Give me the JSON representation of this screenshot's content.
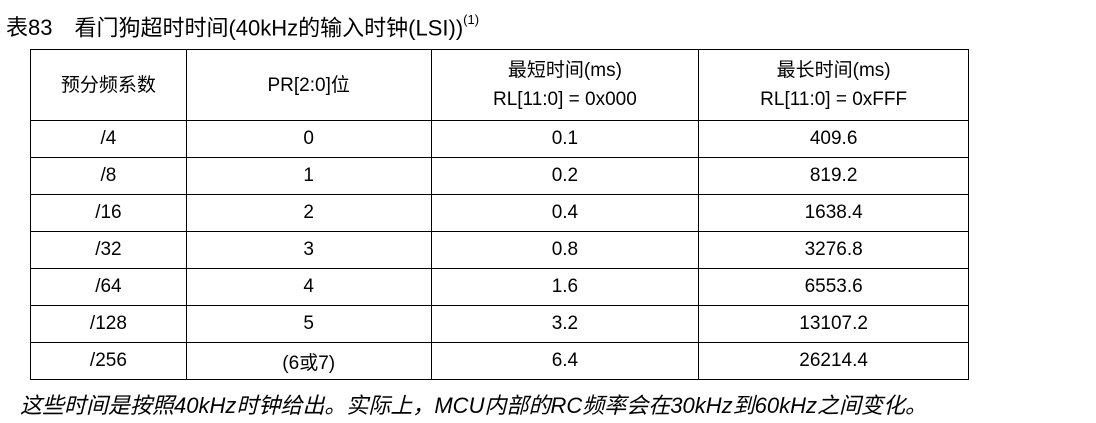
{
  "caption": {
    "number": "表83",
    "title": "看门狗超时时间(40kHz的输入时钟(LSI))",
    "footnote_ref": "(1)"
  },
  "table": {
    "headers": [
      {
        "line1": "预分频系数",
        "line2": ""
      },
      {
        "line1": "PR[2:0]位",
        "line2": ""
      },
      {
        "line1": "最短时间(ms)",
        "line2": "RL[11:0] = 0x000"
      },
      {
        "line1": "最长时间(ms)",
        "line2": "RL[11:0] = 0xFFF"
      }
    ],
    "rows": [
      [
        "/4",
        "0",
        "0.1",
        "409.6"
      ],
      [
        "/8",
        "1",
        "0.2",
        "819.2"
      ],
      [
        "/16",
        "2",
        "0.4",
        "1638.4"
      ],
      [
        "/32",
        "3",
        "0.8",
        "3276.8"
      ],
      [
        "/64",
        "4",
        "1.6",
        "6553.6"
      ],
      [
        "/128",
        "5",
        "3.2",
        "13107.2"
      ],
      [
        "/256",
        "(6或7)",
        "6.4",
        "26214.4"
      ]
    ]
  },
  "note": "这些时间是按照40kHz时钟给出。实际上，MCU内部的RC频率会在30kHz到60kHz之间变化。"
}
